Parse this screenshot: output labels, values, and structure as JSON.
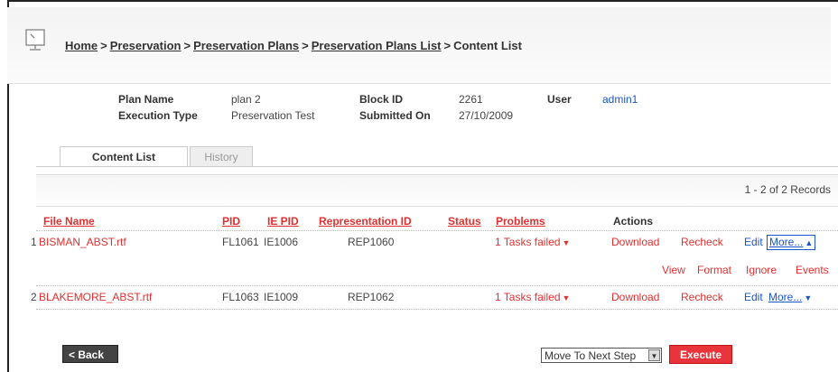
{
  "breadcrumb": {
    "home": "Home",
    "preservation": "Preservation",
    "plans": "Preservation Plans",
    "plans_list": "Preservation Plans List",
    "current": "Content List",
    "separator": ">"
  },
  "details": {
    "plan_name_label": "Plan Name",
    "plan_name": "plan 2",
    "execution_type_label": "Execution Type",
    "execution_type": "Preservation Test",
    "block_id_label": "Block ID",
    "block_id": "2261",
    "submitted_on_label": "Submitted On",
    "submitted_on": "27/10/2009",
    "user_label": "User",
    "user": "admin1"
  },
  "tabs": [
    {
      "label": "Content List",
      "active": true
    },
    {
      "label": "History",
      "active": false
    }
  ],
  "records_text": "1 - 2 of 2 Records",
  "table": {
    "headers": {
      "file_name": "File Name",
      "pid": "PID",
      "ie_pid": "IE PID",
      "rep_id": "Representation ID",
      "status": "Status",
      "problems": "Problems",
      "actions": "Actions"
    },
    "rows": [
      {
        "index": "1",
        "file_name": "BISMAN_ABST.rtf",
        "pid": "FL1061",
        "ie_pid": "IE1006",
        "rep_id": "REP1060",
        "status": "",
        "problems": "1 Tasks failed",
        "actions": {
          "download": "Download",
          "recheck": "Recheck",
          "edit": "Edit",
          "more": "More..."
        },
        "expanded_actions": {
          "view": "View",
          "format": "Format",
          "ignore": "Ignore",
          "events": "Events"
        }
      },
      {
        "index": "2",
        "file_name": "BLAKEMORE_ABST.rtf",
        "pid": "FL1063",
        "ie_pid": "IE1009",
        "rep_id": "REP1062",
        "status": "",
        "problems": "1 Tasks failed",
        "actions": {
          "download": "Download",
          "recheck": "Recheck",
          "edit": "Edit",
          "more": "More..."
        }
      }
    ]
  },
  "footer": {
    "back_label": "< Back",
    "step_select": "Move To Next Step",
    "execute_label": "Execute"
  },
  "icons": {
    "page": "monitor-icon",
    "dropdown": "caret-down-icon",
    "collapse": "caret-up-icon"
  },
  "colors": {
    "accent_red": "#e03030",
    "link_blue": "#1a56c8",
    "execute_bg": "#e8343a"
  }
}
